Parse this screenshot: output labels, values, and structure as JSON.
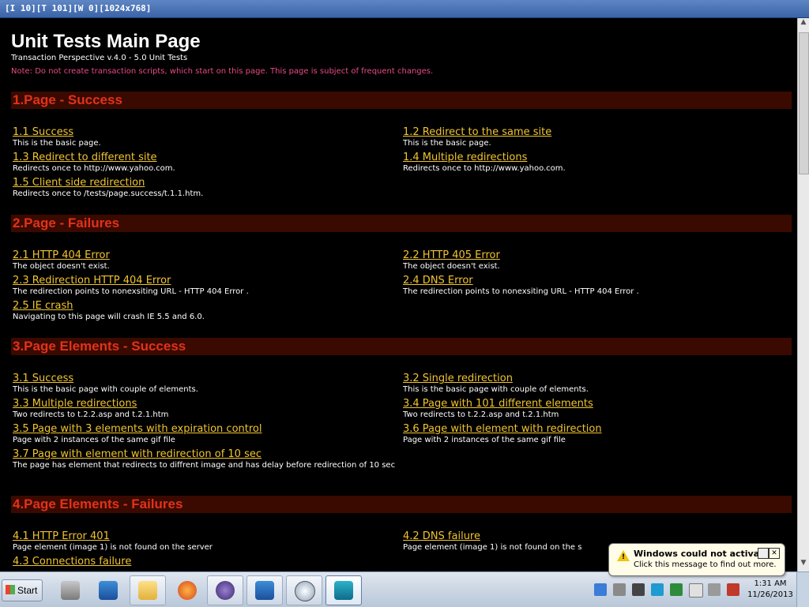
{
  "window": {
    "title": "[I 10][T 101][W 0][1024x768]"
  },
  "header": {
    "title": "Unit Tests Main Page",
    "subtitle": "Transaction Perspective v.4.0 - 5.0 Unit Tests",
    "note": "Note: Do not create transaction scripts, which start on this page. This page is subject of frequent changes."
  },
  "sections": [
    {
      "title": "1.Page - Success",
      "items": [
        {
          "link": "1.1 Success",
          "desc": "This is the basic page."
        },
        {
          "link": "1.2 Redirect to the same site",
          "desc": "This is the basic page."
        },
        {
          "link": "1.3 Redirect to different site",
          "desc": "Redirects once to http://www.yahoo.com."
        },
        {
          "link": "1.4 Multiple redirections",
          "desc": "Redirects once to http://www.yahoo.com."
        },
        {
          "link": "1.5 Client side redirection",
          "desc": "Redirects once to /tests/page.success/t.1.1.htm."
        }
      ]
    },
    {
      "title": "2.Page - Failures",
      "items": [
        {
          "link": "2.1 HTTP 404 Error",
          "desc": "The object doesn't exist."
        },
        {
          "link": "2.2 HTTP 405 Error",
          "desc": "The object doesn't exist."
        },
        {
          "link": "2.3 Redirection HTTP 404 Error",
          "desc": "The redirection points to nonexsiting URL - HTTP 404 Error ."
        },
        {
          "link": "2.4 DNS Error",
          "desc": "The redirection points to nonexsiting URL - HTTP 404 Error ."
        },
        {
          "link": "2.5 IE crash",
          "desc": "Navigating to this page will crash IE 5.5 and 6.0."
        }
      ]
    },
    {
      "title": "3.Page Elements - Success",
      "items": [
        {
          "link": "3.1 Success",
          "desc": "This is the basic page with couple of elements."
        },
        {
          "link": "3.2 Single redirection",
          "desc": "This is the basic page with couple of elements."
        },
        {
          "link": "3.3 Multiple redirections",
          "desc": "Two redirects to t.2.2.asp and t.2.1.htm"
        },
        {
          "link": "3.4 Page with 101 different elements",
          "desc": "Two redirects to t.2.2.asp and t.2.1.htm"
        },
        {
          "link": "3.5 Page with 3 elements with expiration control",
          "desc": "Page with 2 instances of the same gif file"
        },
        {
          "link": "3.6 Page with element with redirection",
          "desc": "Page with 2 instances of the same gif file"
        },
        {
          "link": "3.7 Page with element with redirection of 10 sec",
          "desc": "The page has element that redirects to diffrent image and has delay before redirection of 10 sec"
        }
      ]
    },
    {
      "title": "4.Page Elements - Failures",
      "items": [
        {
          "link": "4.1 HTTP Error 401",
          "desc": "Page element (image 1) is not found on the server"
        },
        {
          "link": "4.2 DNS failure",
          "desc": "Page element (image 1) is not found on the s"
        },
        {
          "link": "4.3 Connections failure",
          "desc": ""
        }
      ]
    }
  ],
  "taskbar": {
    "start_label": "Start",
    "clock_time": "1:31 AM",
    "clock_date": "11/26/2013"
  },
  "notification": {
    "title": "Windows could not activate",
    "message": "Click this message to find out more."
  },
  "colors": {
    "link": "#f0c430",
    "section_title": "#e2321a",
    "note": "#e84a86",
    "background": "#000000"
  }
}
